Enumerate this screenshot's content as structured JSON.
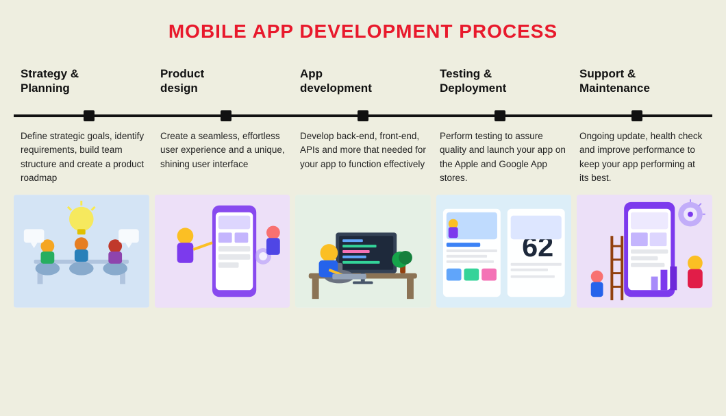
{
  "page": {
    "title": "MOBILE APP DEVELOPMENT PROCESS",
    "background": "#eeeee0"
  },
  "steps": [
    {
      "id": "strategy",
      "title": "Strategy &\nPlanning",
      "description": "Define strategic goals, identify requirements, build team structure and create a product roadmap",
      "image_bg": "#d4e4f5",
      "image_label": "strategy-illustration"
    },
    {
      "id": "product",
      "title": "Product\ndesign",
      "description": "Create a seamless, effortless user experience and a unique, shining user interface",
      "image_bg": "#ede0f8",
      "image_label": "product-design-illustration"
    },
    {
      "id": "appdev",
      "title": "App\ndevelopment",
      "description": "Develop back-end, front-end, APIs and more that needed for your app to function effectively",
      "image_bg": "#e5f0e5",
      "image_label": "app-development-illustration"
    },
    {
      "id": "testing",
      "title": "Testing &\nDeployment",
      "description": "Perform testing to assure quality and launch your app on the Apple and Google App stores.",
      "image_bg": "#dceef8",
      "image_label": "testing-illustration"
    },
    {
      "id": "support",
      "title": "Support &\nMaintenance",
      "description": "Ongoing update, health check and improve performance to keep your app performing at its best.",
      "image_bg": "#ece0f8",
      "image_label": "support-illustration"
    }
  ]
}
